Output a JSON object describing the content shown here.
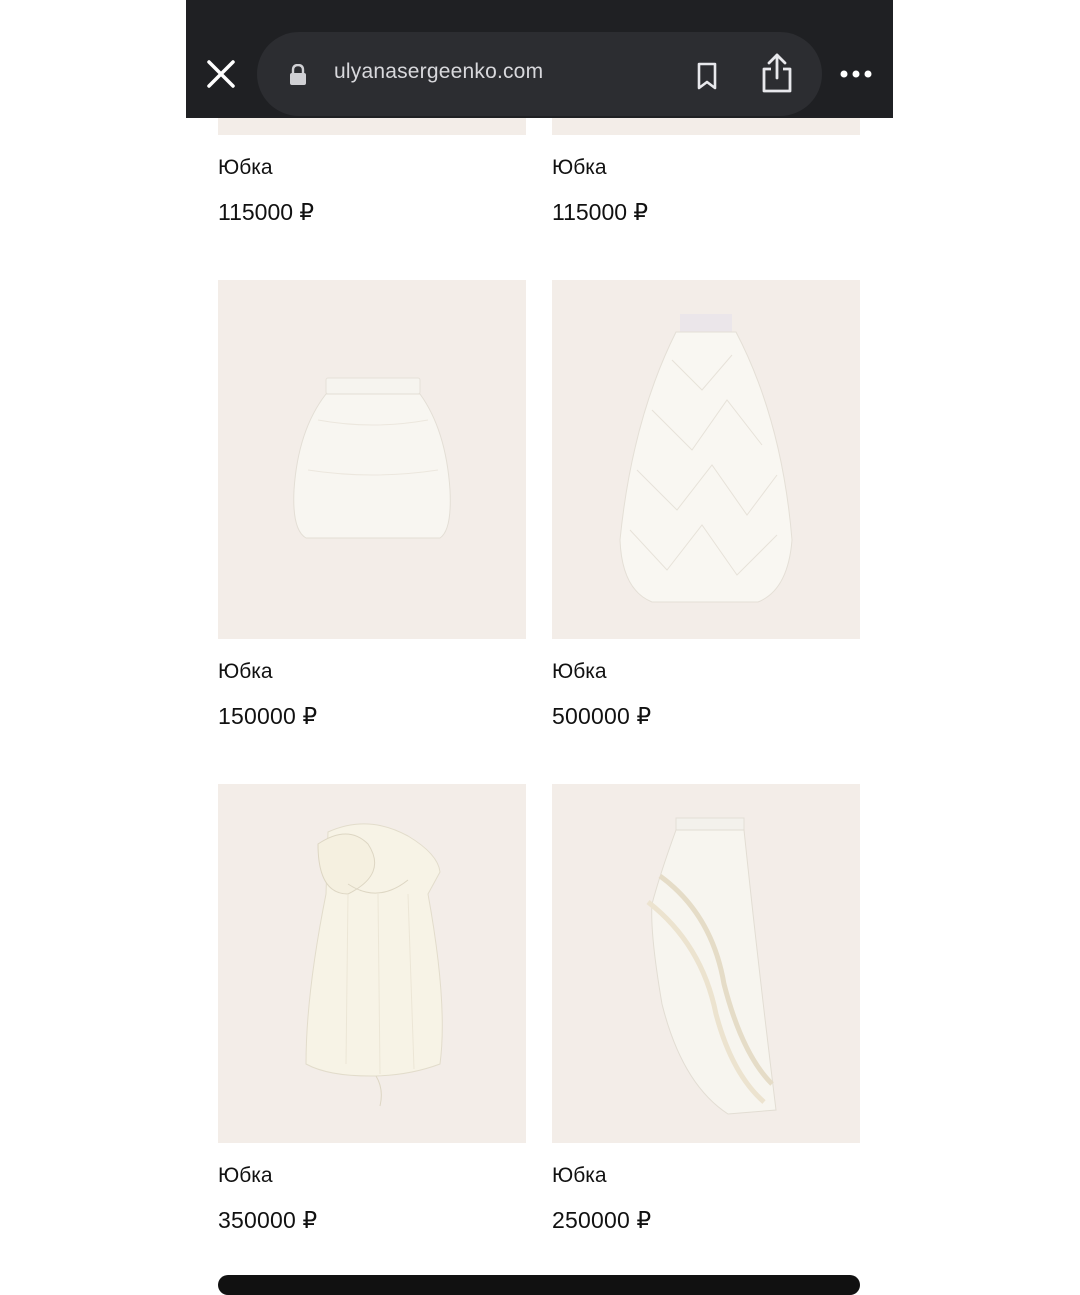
{
  "browser": {
    "url": "ulyanasergeenko.com"
  },
  "products": [
    {
      "name": "Юбка",
      "price": "115000 ₽"
    },
    {
      "name": "Юбка",
      "price": "115000 ₽"
    },
    {
      "name": "Юбка",
      "price": "150000 ₽"
    },
    {
      "name": "Юбка",
      "price": "500000 ₽"
    },
    {
      "name": "Юбка",
      "price": "350000 ₽"
    },
    {
      "name": "Юбка",
      "price": "250000 ₽"
    }
  ],
  "colors": {
    "browser_bar": "#1f2023",
    "url_pill": "#2c2d31",
    "photo_background": "#f3ede8",
    "garment": "#faf8f3"
  },
  "icons": [
    "close-icon",
    "lock-icon",
    "bookmark-icon",
    "share-icon",
    "more-icon"
  ]
}
